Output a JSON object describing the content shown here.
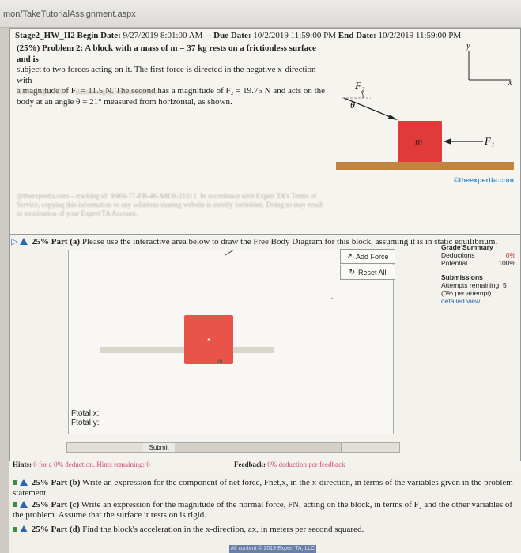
{
  "browser": {
    "url": "mon/TakeTutorialAssignment.aspx"
  },
  "problem": {
    "stage": "Stage2_HW_II2",
    "begin_label": "Begin Date:",
    "begin_date": "9/27/2019 8:01:00 AM",
    "due_label": "Due Date:",
    "due_date": "10/2/2019 11:59:00 PM",
    "end_label": "End Date:",
    "end_date": "10/2/2019 11:59:00 PM",
    "lines": [
      "(25%) Problem 2:  A block with a mass of m = 37 kg rests on a frictionless surface and is",
      "subject to two forces acting on it. The first force is directed in the negative x-direction with",
      "a magnitude of F₁ = 11.5 N. The second has a magnitude of F₂ = 19.75 N and acts on the",
      "body at an angle θ = 21° measured from horizontal, as shown."
    ],
    "watermark_lines": [
      "Kimbrough, Riley – rkimbrough@salemstate.edu",
      "@theexpertta.com – tracking id: 9N69-77-EB-46-A8D8-21612. In accordance with Expert TA's Terms of",
      "Service, copying this information to any solutions sharing website is strictly forbidden. Doing so may result",
      "in termination of your Expert TA Account."
    ],
    "credit": "©theexpertta.com",
    "diagram": {
      "f2_label": "F₂",
      "theta_label": "θ",
      "mass_label": "m",
      "f1_label": "F₁",
      "axis_y": "y",
      "axis_x": "x",
      "block_color": "#e03a3a"
    }
  },
  "part_a": {
    "percent": "25%",
    "part_label": "Part (a)",
    "prompt": "Please use the interactive area below to draw the Free Body Diagram for this block, assuming it is in static equilibrium.",
    "add_force": "Add Force",
    "reset_all": "Reset All",
    "canvas_mass_label": "m",
    "ftotal_x": "Ftotal,x:",
    "ftotal_y": "Ftotal,y:",
    "submit": "Submit",
    "hints_label": "Hints:",
    "hints_text": "0 for a 0% deduction. Hints remaining: 0",
    "feedback_label": "Feedback:",
    "feedback_text": "0% deduction per feedback"
  },
  "grade_summary": {
    "title": "Grade Summary",
    "rows": [
      {
        "label": "Deductions",
        "value": "0%"
      },
      {
        "label": "Potential",
        "value": "100%"
      }
    ],
    "submissions_title": "Submissions",
    "attempts": "Attempts remaining: 5",
    "per_attempt": "(0% per attempt)",
    "detailed_view": "detailed view"
  },
  "other_parts": [
    {
      "percent": "25%",
      "label": "Part (b)",
      "text": "Write an expression for the component of net force, Fnet,x, in the x-direction, in terms of the variables given in the problem statement."
    },
    {
      "percent": "25%",
      "label": "Part (c)",
      "text": "Write an expression for the magnitude of the normal force, FN, acting on the block, in terms of F₂ and the other variables of the problem. Assume that the surface it rests on is rigid."
    },
    {
      "percent": "25%",
      "label": "Part (d)",
      "text": "Find the block's acceleration in the x-direction, ax, in meters per second squared."
    }
  ],
  "footer": {
    "text": "All content © 2019 Expert TA, LLC"
  },
  "colors": {
    "accent_blue": "#2b67b5",
    "block_red": "#e03a3a",
    "canvas_block": "#e8544a",
    "pink": "#d04a7a"
  }
}
